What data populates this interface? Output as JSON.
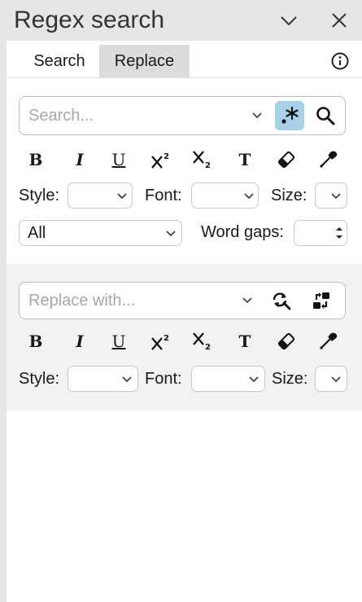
{
  "title": "Regex search",
  "tabs": {
    "search": "Search",
    "replace": "Replace"
  },
  "search": {
    "placeholder": "Search...",
    "style_label": "Style:",
    "font_label": "Font:",
    "size_label": "Size:",
    "scope_value": "All",
    "word_gaps_label": "Word gaps:",
    "style_value": "",
    "font_value": "",
    "size_value": "",
    "word_gaps_value": ""
  },
  "replace": {
    "placeholder": "Replace with...",
    "style_label": "Style:",
    "font_label": "Font:",
    "size_label": "Size:",
    "style_value": "",
    "font_value": "",
    "size_value": ""
  },
  "format_buttons": {
    "bold": "B",
    "italic": "I",
    "underline": "U",
    "text": "T"
  },
  "icons": [
    "chevron-down-icon",
    "close-icon",
    "info-icon",
    "regex-icon",
    "search-icon",
    "superscript-icon",
    "subscript-icon",
    "eraser-icon",
    "eyedropper-icon",
    "replace-icon",
    "replace-all-icon"
  ],
  "colors": {
    "accent": "#a6d2e9",
    "selected_tab": "#dcdcdc",
    "chrome": "#e6e6e6",
    "replace_bg": "#f2f2f2"
  }
}
